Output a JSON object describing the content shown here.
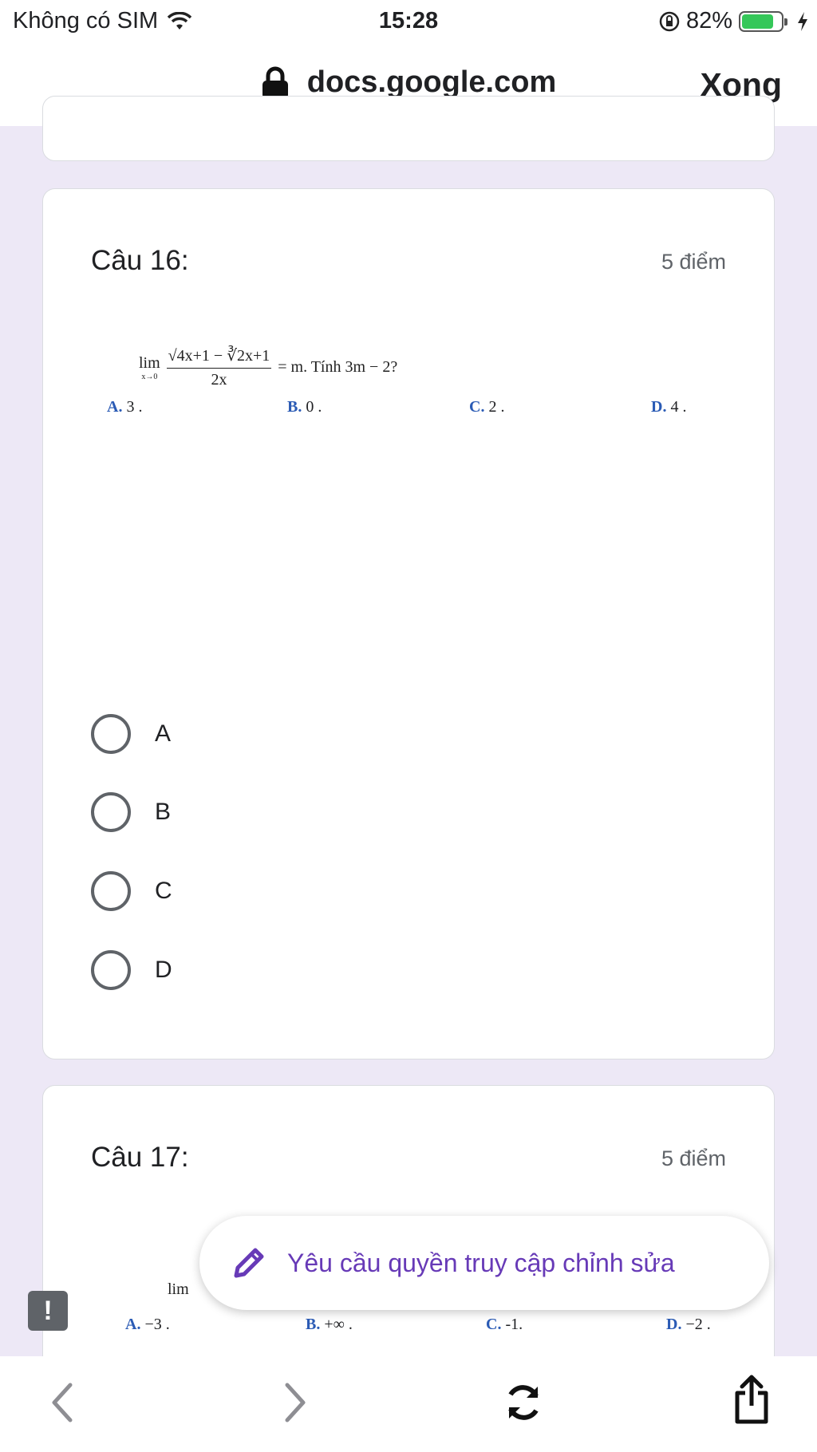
{
  "status_bar": {
    "carrier": "Không có SIM",
    "time": "15:28",
    "battery": "82%",
    "battery_level": 0.82
  },
  "browser": {
    "url": "docs.google.com",
    "done_label": "Xong"
  },
  "questions": [
    {
      "title": "Câu 16:",
      "points": "5 điểm",
      "formula": {
        "lim": "lim",
        "sub": "x→0",
        "numerator": "√4x+1 − ∛2x+1",
        "denominator": "2x",
        "rest": "= m. Tính 3m − 2?"
      },
      "answers": [
        {
          "letter": "A.",
          "value": "3 ."
        },
        {
          "letter": "B.",
          "value": "0 ."
        },
        {
          "letter": "C.",
          "value": "2 ."
        },
        {
          "letter": "D.",
          "value": "4 ."
        }
      ],
      "choices": [
        "A",
        "B",
        "C",
        "D"
      ]
    },
    {
      "title": "Câu 17:",
      "points": "5 điểm",
      "formula": {
        "lim": "lim"
      },
      "answers": [
        {
          "letter": "A.",
          "value": "−3 ."
        },
        {
          "letter": "B.",
          "value": "+∞ ."
        },
        {
          "letter": "C.",
          "value": "-1."
        },
        {
          "letter": "D.",
          "value": "−2 ."
        }
      ]
    }
  ],
  "toast": {
    "label": "Yêu cầu quyền truy cập chỉnh sửa"
  },
  "icons": [
    "wifi-icon",
    "orientation-lock-icon",
    "charging-icon",
    "lock-icon",
    "pencil-icon",
    "feedback-icon",
    "back-icon",
    "forward-icon",
    "reload-icon",
    "share-icon"
  ],
  "colors": {
    "accent": "#673ab7",
    "background": "#ede8f6",
    "answer_letter": "#2b5bb5"
  }
}
